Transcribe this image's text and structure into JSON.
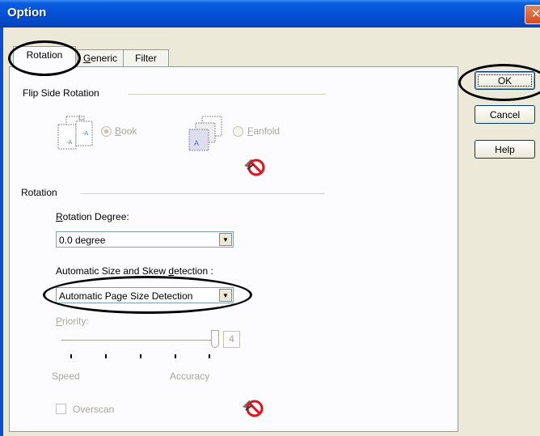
{
  "window": {
    "title": "Option",
    "close_glyph": "✕"
  },
  "tabs": [
    {
      "label": "Rotation",
      "active": true
    },
    {
      "pre": "",
      "acc": "G",
      "post": "eneric",
      "active": false
    },
    {
      "label": "Filter",
      "active": false
    }
  ],
  "flip_side": {
    "heading": "Flip Side Rotation",
    "book": {
      "acc": "B",
      "rest": "ook",
      "selected": true
    },
    "fanfold": {
      "acc": "F",
      "rest": "anfold",
      "selected": false
    },
    "unavailable_icon": "no-entry-icon"
  },
  "rotation": {
    "heading": "Rotation",
    "degree_label_acc": "R",
    "degree_label_rest": "otation Degree:",
    "degree_value": "0.0 degree",
    "skew_label_pre": "Automatic Size and Skew ",
    "skew_label_acc": "d",
    "skew_label_post": "etection :",
    "skew_value": "Automatic Page Size Detection",
    "priority_label_acc": "P",
    "priority_label_rest": "riority:",
    "priority_value": "4",
    "priority_level": 4,
    "priority_max": 4,
    "speed_label": "Speed",
    "accuracy_label": "Accuracy",
    "overscan_label": "Overscan",
    "overscan_checked": false,
    "unavailable_icon": "no-entry-icon"
  },
  "buttons": {
    "ok": "OK",
    "cancel": "Cancel",
    "help": "Help"
  },
  "colors": {
    "titlebar": "#0550d6",
    "dialog_bg": "#ece9d8",
    "disabled_text": "#a9a797",
    "no_entry": "#e0121b"
  }
}
